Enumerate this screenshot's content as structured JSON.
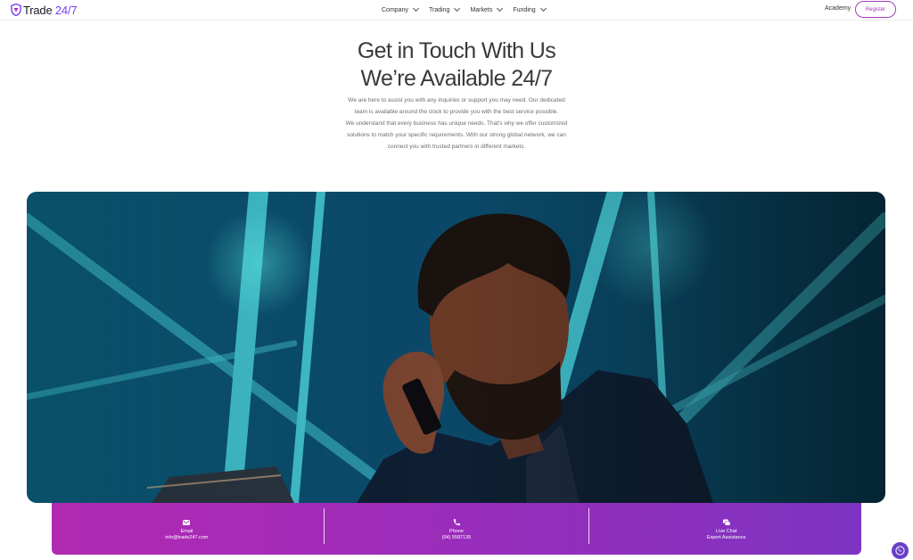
{
  "brand": {
    "name_part1": "Trade",
    "name_part2": " 24/7"
  },
  "nav": {
    "menu": [
      {
        "label": "Company"
      },
      {
        "label": "Trading"
      },
      {
        "label": "Markets"
      },
      {
        "label": "Funding"
      }
    ],
    "academy_label": "Academy",
    "register_label": "Register"
  },
  "hero": {
    "title_line1": "Get in Touch With Us",
    "title_line2": "We’re Available 24/7",
    "para1": "We are here to assist you with any inquiries or support you may need. Our dedicated team is available around the clock to provide you with the best service possible.",
    "para2": "We understand that every business has unique needs. That's why we offer customized solutions to match your specific requirements. With our strong global network, we can connect you with trusted partners in different markets."
  },
  "contact": {
    "email": {
      "icon": "mail-icon",
      "label": "Email",
      "value": "info@trade247.com"
    },
    "phone": {
      "icon": "phone-icon",
      "label": "Phone",
      "value": "(04) 5587135"
    },
    "chat": {
      "icon": "chat-icon",
      "label": "Live Chat",
      "value": "Expert Assistance"
    }
  },
  "colors": {
    "accent": "#a23bbf",
    "bar_start": "#b12ab2",
    "bar_end": "#7e33c2",
    "fab": "#6a3fc7"
  }
}
